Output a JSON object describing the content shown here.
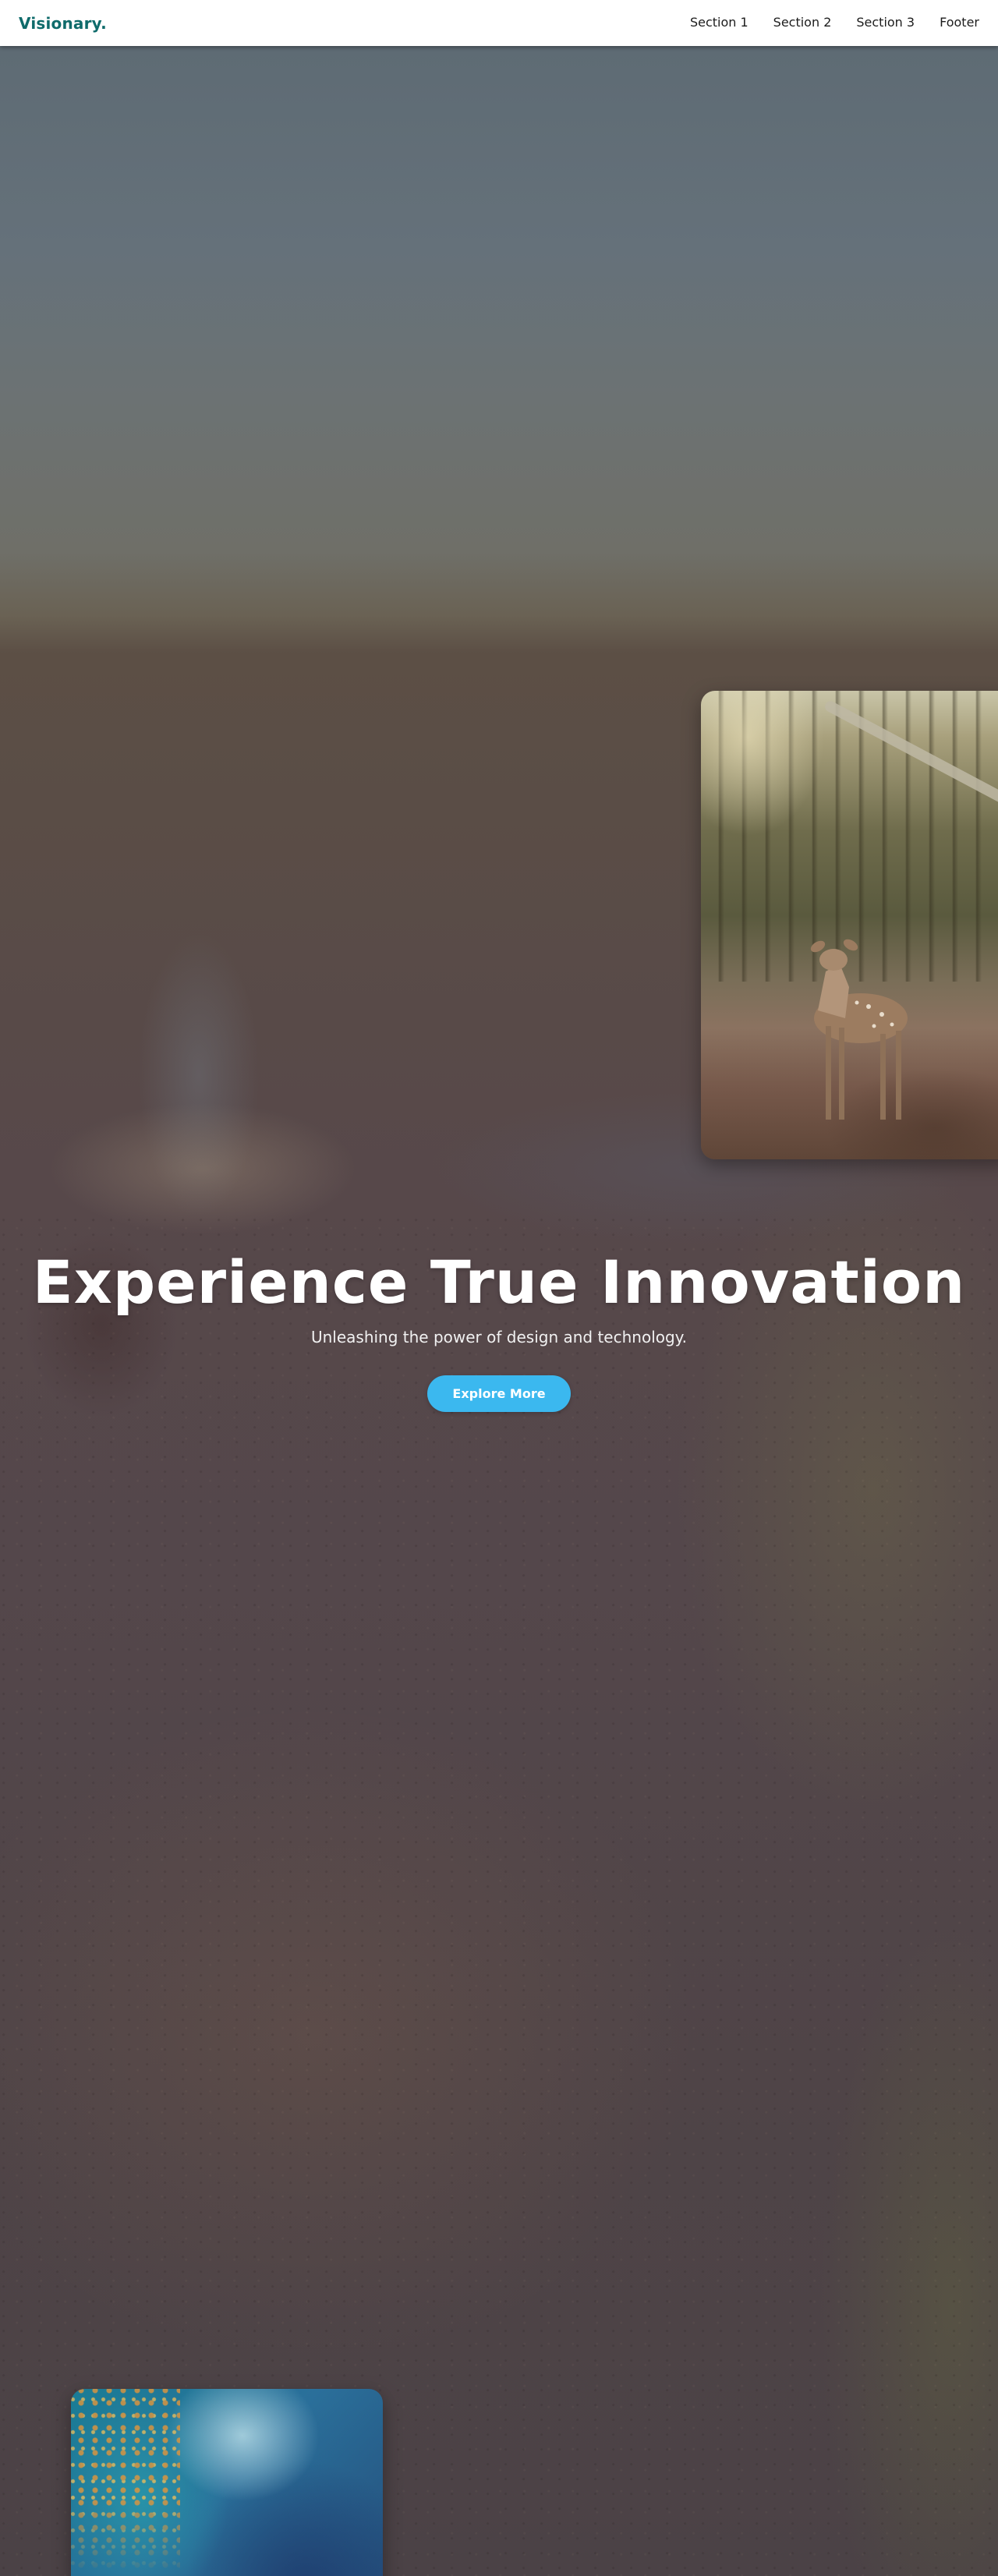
{
  "navbar": {
    "brand": "Visionary.",
    "links": [
      {
        "label": "Section 1"
      },
      {
        "label": "Section 2"
      },
      {
        "label": "Section 3"
      },
      {
        "label": "Footer"
      }
    ]
  },
  "hero": {
    "title": "Experience True Innovation",
    "subtitle": "Unleashing the power of design and technology.",
    "cta_label": "Explore More"
  },
  "colors": {
    "brand": "#0f6b6b",
    "cta": "#3bb8ef",
    "navbar_bg": "#ffffff",
    "hero_text": "#ffffff"
  },
  "images": [
    {
      "name": "deer-in-forest-image"
    },
    {
      "name": "ocean-aerial-image"
    }
  ]
}
